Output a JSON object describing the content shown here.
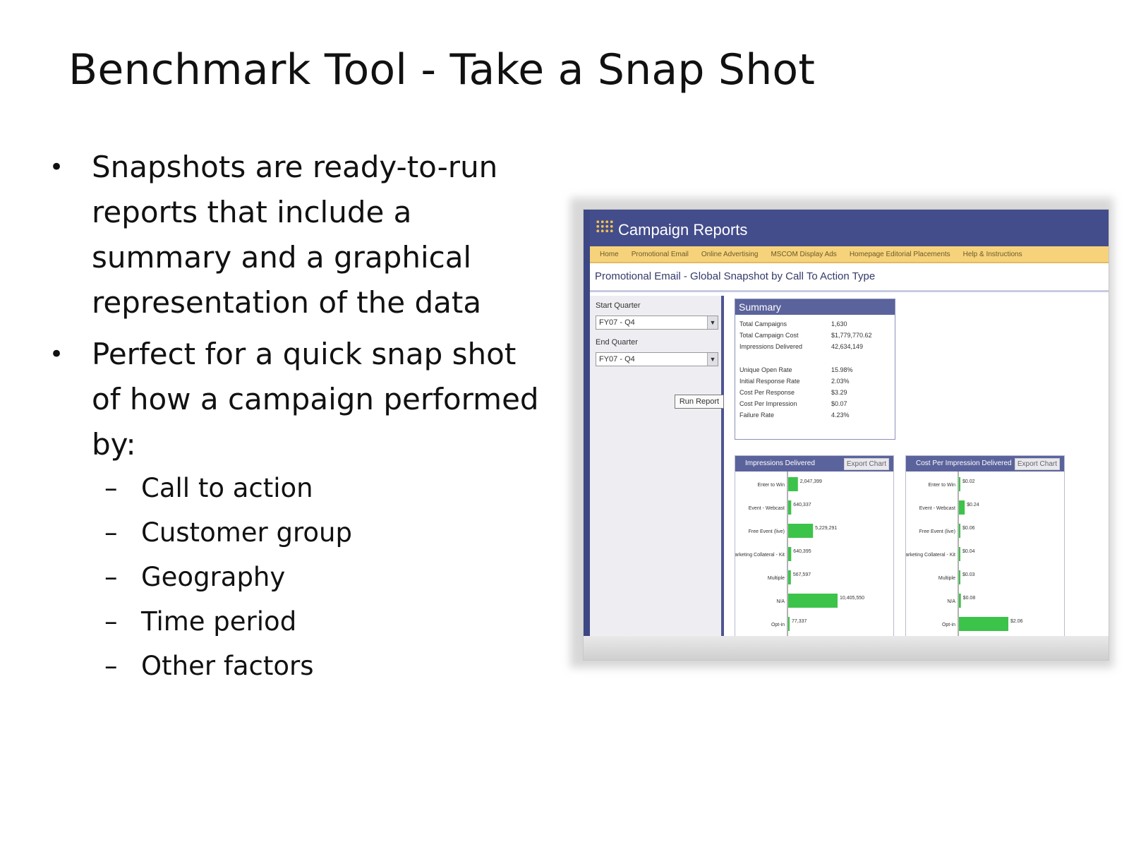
{
  "slide": {
    "title": "Benchmark Tool - Take a Snap Shot",
    "bullets": [
      "Snapshots are ready-to-run",
      "reports that include a",
      "summary and a graphical",
      "representation of the data"
    ],
    "bullet2": [
      "Perfect for a quick snap shot",
      "of how a campaign performed",
      "by:"
    ],
    "bullet_mark": "•",
    "sub_mark": "–",
    "subitems": [
      "Call to action",
      "Customer group",
      "Geography",
      "Time period",
      "Other factors"
    ]
  },
  "app": {
    "title": "Campaign Reports",
    "nav": [
      "Home",
      "Promotional Email",
      "Online Advertising",
      "MSCOM Display Ads",
      "Homepage Editorial Placements",
      "Help & Instructions"
    ],
    "report_title": "Promotional Email - Global Snapshot by Call To Action Type",
    "start_label": "Start Quarter",
    "start_value": "FY07 - Q4",
    "end_label": "End Quarter",
    "end_value": "FY07 - Q4",
    "run_button": "Run Report",
    "summary_title": "Summary",
    "summary_rows": [
      {
        "label": "Total Campaigns",
        "value": "1,630"
      },
      {
        "label": "Total Campaign Cost",
        "value": "$1,779,770.62"
      },
      {
        "label": "Impressions Delivered",
        "value": "42,634,149"
      },
      {
        "label": "Unique Open Rate",
        "value": "15.98%"
      },
      {
        "label": "Initial Response Rate",
        "value": "2.03%"
      },
      {
        "label": "Cost Per Response",
        "value": "$3.29"
      },
      {
        "label": "Cost Per Impression",
        "value": "$0.07"
      },
      {
        "label": "Failure Rate",
        "value": "4.23%"
      }
    ],
    "export_label": "Export Chart",
    "accent": "#444d8b",
    "nav_color": "#f6d37b",
    "bar_color": "#3cc34a"
  },
  "chart_data": [
    {
      "type": "bar",
      "title": "Impressions Delivered",
      "orientation": "horizontal",
      "categories": [
        "Enter to Win",
        "Event - Webcast",
        "Free Event (live)",
        "Marketing Collateral - Kit",
        "Multiple",
        "N/A",
        "Opt-in"
      ],
      "values": [
        2047399,
        640337,
        5229291,
        640395,
        567597,
        10405550,
        77337
      ],
      "labels": [
        "2,047,399",
        "640,337",
        "5,229,291",
        "640,395",
        "567,597",
        "10,405,550",
        "77,337"
      ]
    },
    {
      "type": "bar",
      "title": "Cost Per Impression Delivered",
      "orientation": "horizontal",
      "categories": [
        "Enter to Win",
        "Event - Webcast",
        "Free Event (live)",
        "Marketing Collateral - Kit",
        "Multiple",
        "N/A",
        "Opt-in"
      ],
      "values": [
        0.02,
        0.24,
        0.06,
        0.04,
        0.03,
        0.08,
        2.06
      ],
      "labels": [
        "$0.02",
        "$0.24",
        "$0.06",
        "$0.04",
        "$0.03",
        "$0.08",
        "$2.06"
      ]
    }
  ]
}
